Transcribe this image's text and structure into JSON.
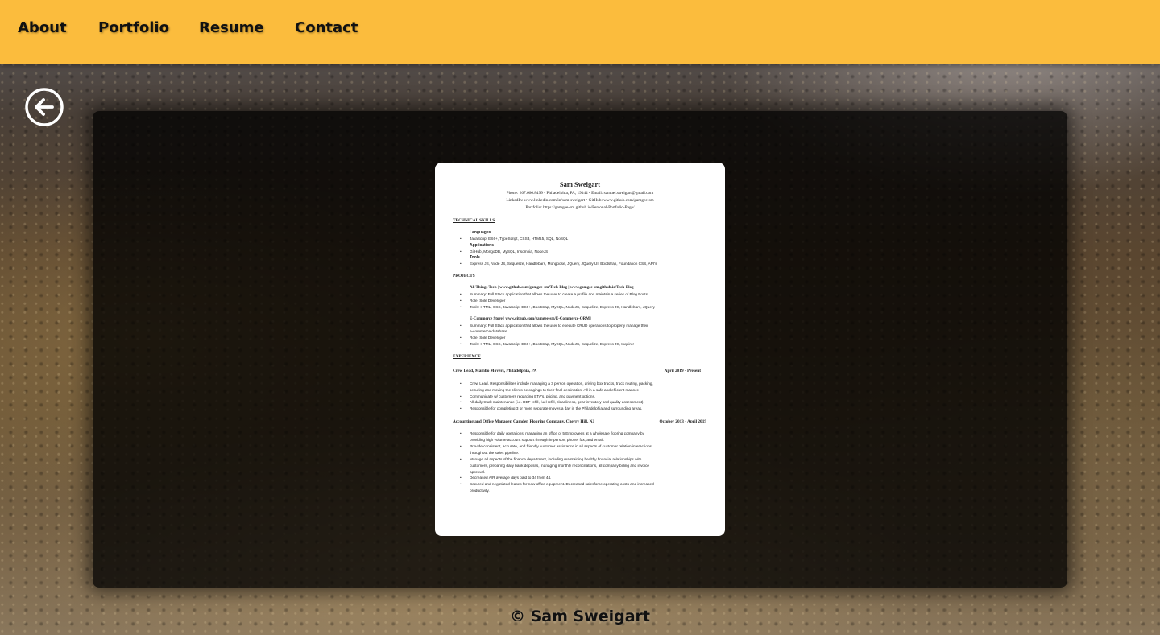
{
  "nav": {
    "items": [
      {
        "label": "About"
      },
      {
        "label": "Portfolio"
      },
      {
        "label": "Resume"
      },
      {
        "label": "Contact"
      }
    ],
    "bg_color": "#fbbc3d"
  },
  "back_icon": "arrow-left-circle-icon",
  "resume": {
    "name": "Sam Sweigart",
    "contact_line": "Phone: 267.666.8499 • Philadelphia, PA, 19144 • Email: samuel.sweigart@gmail.com",
    "links_line": "LinkedIn: www.linkedin.com/in/sam-sweigart • GitHub: www.github.com/gamgee-sm",
    "portfolio_line": "Portfolio: https://gamgee-sm.github.io/Personal-Portfolio-Page/",
    "technical_skills": {
      "heading": "TECHNICAL SKILLS",
      "languages_label": "Languages",
      "languages": "JavaScript ES6+, TypeScript, CSS3, HTML5, SQL, NoSQL",
      "applications_label": "Applications",
      "applications": "GitHub, MongoDB, MySQL, Insomnia, NodeJS",
      "tools_label": "Tools",
      "tools": "Express JS, Node JS, Sequelize, Handlebars, Mongoose, JQuery, JQuery UI, Bootstrap, Foundation CSS, API's"
    },
    "projects": {
      "heading": "PROJECTS",
      "p1_title": "All Things Tech | www.github.com/gamgee-sm/Tech-Blog | www.gamgee-sm.github.io/Tech-Blog",
      "p1_summary": "Summary: Full Stack application that allows the user to create a profile and maintain a series of Blog Posts",
      "p1_role": "Role: Sole Developer",
      "p1_tools": "Tools: HTML, CSS, JavaScript ES6+, Bootstrap, MySQL, NodeJS, Sequelize, Express JS, Handlebars, JQuery",
      "p2_title": "E-Commerce Store | www.github.com/gamgee-sm/E-Commerce-ORM |",
      "p2_summary": "Summary: Full Stack application that allows the user to execute CRUD operations to properly manage their",
      "p2_summary2": "e-commerce database",
      "p2_role": "Role: Sole Developer",
      "p2_tools": "Tools: HTML, CSS, JavaScript ES6+, Bootstrap, MySQL, NodeJS, Sequelize, Express JS, Inquirer"
    },
    "experience": {
      "heading": "EXPERIENCE",
      "job1_title": "Crew Lead, Mambo Movers, Philadelphia, PA",
      "job1_dates": "April 2019 - Present",
      "job1_b1": "Crew Lead. Responsibilities include managing a 3 person operation, driving box trucks, truck routing, packing,",
      "job1_b1b": "securing and moving the clients belongings to their final destination. All in a safe and efficient manner.",
      "job1_b2": "Communicate w/ customers regarding ETA's, pricing, and payment options.",
      "job1_b3": "All daily truck maintenance (i.e. DEF refill, fuel refill, cleanliness, gear inventory and quality assessment).",
      "job1_b4": "Responsible for completing 3 or more separate moves a day in the Philadelphia and surrounding areas.",
      "job2_title": "Accounting and Office Manager, Camden Flooring Company, Cherry Hill, NJ",
      "job2_dates": "October 2013 - April 2019",
      "job2_b1": "Responsible for daily operations, managing an office of 5 Employees at a wholesale flooring company by",
      "job2_b1b": "providing high volume account support through in-person, phone, fax, and email.",
      "job2_b2": "Provide consistent, accurate, and friendly customer assistance in all aspects of customer relation interactions",
      "job2_b2b": "throughout the sales pipeline.",
      "job2_b3": "Manage all aspects of the finance department, including maintaining healthy financial relationships with",
      "job2_b3b": "customers, preparing daily bank deposits, managing monthly reconciliations, all company billing and invoice",
      "job2_b3c": "approval.",
      "job2_b4": "Decreased A/R average days paid to 34 from 44.",
      "job2_b5": "Secured and negotiated leases for new office equipment. Decreased salesforce operating costs and increased",
      "job2_b5b": "productivity."
    }
  },
  "footer": {
    "text": "© Sam Sweigart"
  }
}
